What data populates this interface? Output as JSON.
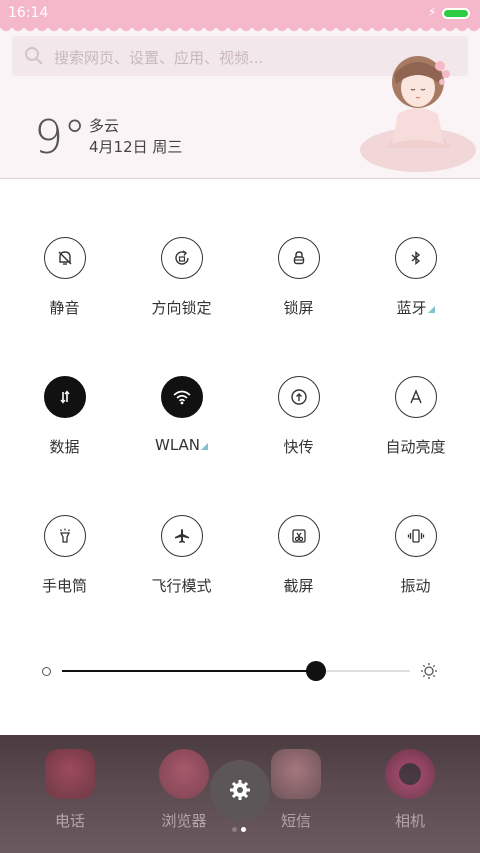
{
  "status_bar": {
    "time": "16:14"
  },
  "header": {
    "search": {
      "placeholder": "搜索网页、设置、应用、视频..."
    },
    "weather": {
      "temperature": "9°",
      "condition": "多云",
      "date": "4月12日 周三"
    }
  },
  "toggles": [
    {
      "label": "静音",
      "icon": "bell-slash-icon",
      "state": "off"
    },
    {
      "label": "方向锁定",
      "icon": "rotation-lock-icon",
      "state": "off"
    },
    {
      "label": "锁屏",
      "icon": "lock-icon",
      "state": "off"
    },
    {
      "label": "蓝牙",
      "icon": "bluetooth-icon",
      "state": "off",
      "expandable": true
    },
    {
      "label": "数据",
      "icon": "data-arrows-icon",
      "state": "on"
    },
    {
      "label": "WLAN",
      "icon": "wifi-icon",
      "state": "on",
      "expandable": true
    },
    {
      "label": "快传",
      "icon": "upload-icon",
      "state": "off"
    },
    {
      "label": "自动亮度",
      "icon": "letter-a-icon",
      "state": "off"
    },
    {
      "label": "手电筒",
      "icon": "flashlight-icon",
      "state": "off"
    },
    {
      "label": "飞行模式",
      "icon": "airplane-icon",
      "state": "off"
    },
    {
      "label": "截屏",
      "icon": "screenshot-scissors-icon",
      "state": "off"
    },
    {
      "label": "振动",
      "icon": "vibrate-icon",
      "state": "off"
    }
  ],
  "brightness": {
    "level": 0.73
  },
  "dock": {
    "items": [
      {
        "label": "电话"
      },
      {
        "label": "浏览器"
      },
      {
        "label": "短信"
      },
      {
        "label": "相机"
      }
    ],
    "page_indicator": {
      "pages": 2,
      "current": 2
    }
  },
  "colors": {
    "status_bar": "#f5b8cb",
    "accent_on": "#111111",
    "expand_indicator": "#7fc3d3"
  }
}
